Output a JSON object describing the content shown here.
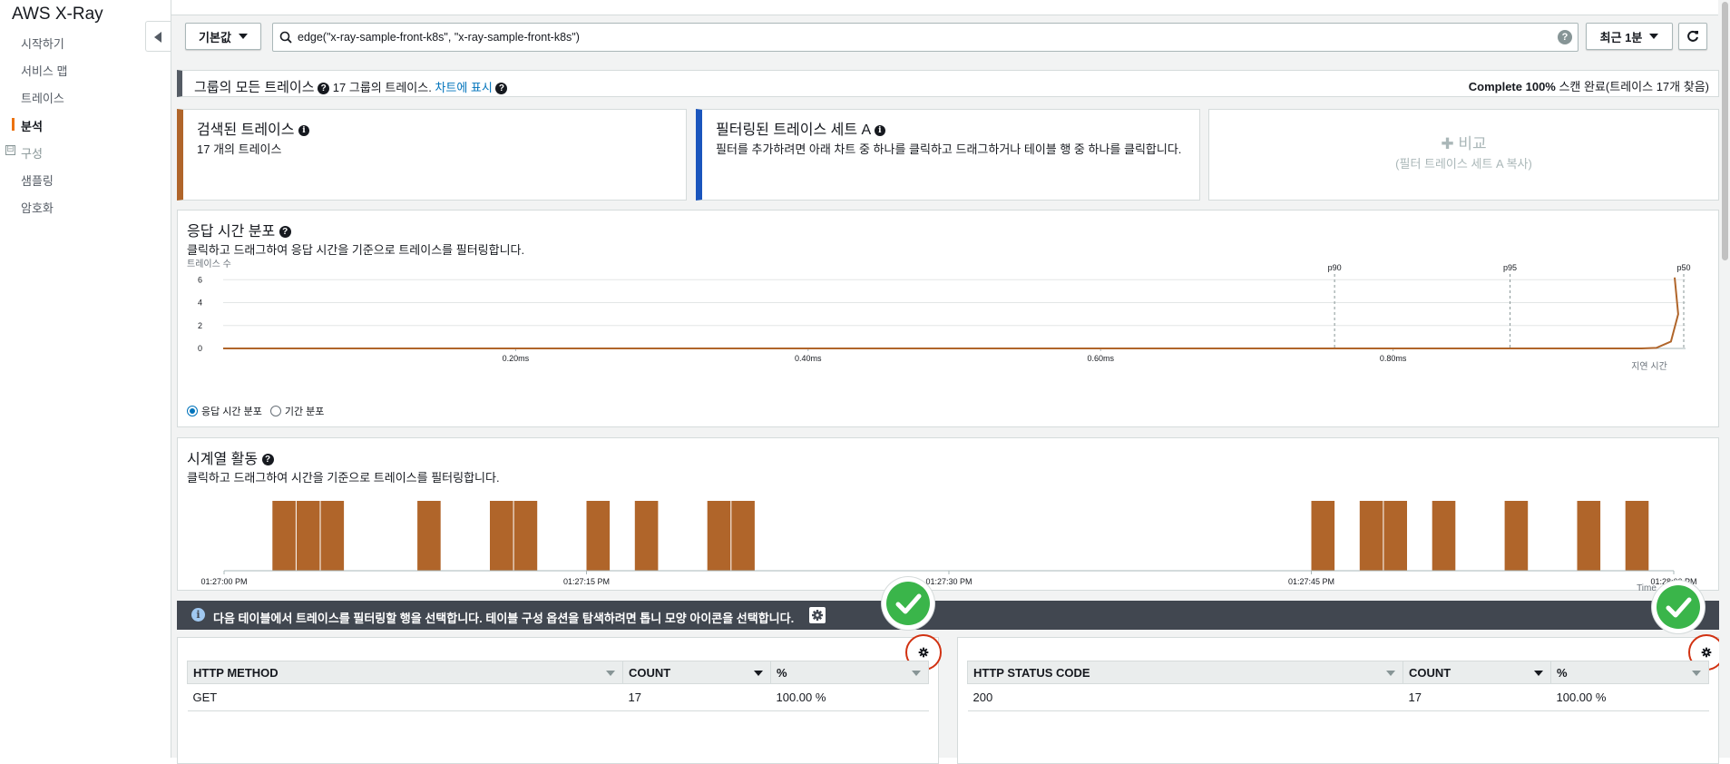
{
  "sidebar": {
    "app_title": "AWS X-Ray",
    "items": [
      {
        "label": "시작하기"
      },
      {
        "label": "서비스 맵"
      },
      {
        "label": "트레이스"
      },
      {
        "label": "분석"
      }
    ],
    "group_label": "구성",
    "group_toggle": "⊟",
    "group_items": [
      {
        "label": "샘플링"
      },
      {
        "label": "암호화"
      }
    ]
  },
  "toolbar": {
    "group_button": "기본값",
    "query": "edge(\"x-ray-sample-front-k8s\", \"x-ray-sample-front-k8s\")",
    "time_button": "최근 1분"
  },
  "status": {
    "title": "그룹의 모든 트레이스",
    "count_text": "17 그룹의 트레이스.",
    "chart_link": "차트에 표시",
    "complete_bold": "Complete 100%",
    "complete_rest": " 스캔 완료(트레이스 17개 찾음)"
  },
  "cards": {
    "retrieved_title": "검색된 트레이스",
    "retrieved_sub": "17 개의 트레이스",
    "filtered_title": "필터링된 트레이스 세트 A",
    "filtered_sub": "필터를 추가하려면 아래 차트 중 하나를 클릭하고 드래그하거나 테이블 행 중 하나를 클릭합니다.",
    "compare_label": "✚ 비교",
    "compare_sub": "(필터 트레이스 세트 A 복사)"
  },
  "response_time": {
    "title": "응답 시간 분포",
    "subtitle": "클릭하고 드래그하여 응답 시간을 기준으로 트레이스를 필터링합니다.",
    "radio_1": "응답 시간 분포",
    "radio_2": "기간 분포"
  },
  "timeseries": {
    "title": "시계열 활동",
    "subtitle": "클릭하고 드래그하여 시간을 기준으로 트레이스를 필터링합니다."
  },
  "info_bar": {
    "text": "다음 테이블에서 트레이스를 필터링할 행을 선택합니다. 테이블 구성 옵션을 탐색하려면 톱니 모양 아이콘을 선택합니다."
  },
  "table_method": {
    "headers": [
      "HTTP METHOD",
      "COUNT",
      "%"
    ],
    "rows": [
      [
        "GET",
        "17",
        "100.00 %"
      ]
    ]
  },
  "table_status": {
    "headers": [
      "HTTP STATUS CODE",
      "COUNT",
      "%"
    ],
    "rows": [
      [
        "200",
        "17",
        "100.00 %"
      ]
    ]
  },
  "colors": {
    "bar": "#b0652a",
    "link": "#0073bb",
    "check": "#3ab54a",
    "highlight_ring": "#d13212"
  },
  "chart_data": [
    {
      "type": "line",
      "ylabel": "트레이스 수",
      "xlabel": "지연 시간",
      "y_ticks": [
        0,
        2,
        4,
        6
      ],
      "x_ticks": [
        "0.20ms",
        "0.40ms",
        "0.60ms",
        "0.80ms"
      ],
      "percentile_markers": [
        {
          "label": "p90",
          "x": 0.76
        },
        {
          "label": "p95",
          "x": 0.88
        },
        {
          "label": "p50",
          "x": 1.0
        }
      ],
      "x": [
        0.0,
        0.2,
        0.4,
        0.6,
        0.8,
        0.97,
        0.98,
        0.99,
        0.995,
        1.0
      ],
      "values": [
        0,
        0,
        0,
        0,
        0,
        0,
        0.05,
        0.6,
        3.0,
        6.2
      ],
      "xlim": [
        0.0,
        1.0
      ],
      "ylim": [
        0,
        6.5
      ],
      "grid": true
    },
    {
      "type": "bar",
      "xlabel": "Time",
      "x_ticks": [
        "01:27:00 PM",
        "01:27:15 PM",
        "01:27:30 PM",
        "01:27:45 PM",
        "01:28:00 PM"
      ],
      "xlim_seconds": [
        0,
        60
      ],
      "bars_seconds": [
        2.5,
        3.5,
        4.5,
        8.5,
        11.5,
        12.5,
        15.5,
        17.5,
        20.5,
        21.5,
        45.5,
        47.5,
        48.5,
        50.5,
        53.5,
        56.5,
        58.5
      ],
      "values": [
        1,
        1,
        1,
        1,
        1,
        1,
        1,
        1,
        1,
        1,
        1,
        1,
        1,
        1,
        1,
        1,
        1
      ]
    }
  ]
}
